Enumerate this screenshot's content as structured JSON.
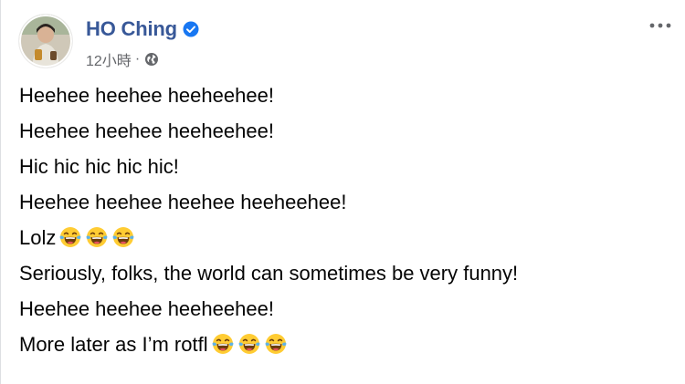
{
  "post": {
    "author": {
      "name": "HO Ching",
      "verified": true
    },
    "timestamp": "12小時",
    "separator": "·",
    "privacy_icon": "globe-icon",
    "more_icon": "more-options-icon",
    "lines": [
      {
        "text": "Heehee heehee heeheehee!",
        "emojis": 0
      },
      {
        "text": "Heehee heehee heeheehee!",
        "emojis": 0
      },
      {
        "text": "Hic hic hic hic hic!",
        "emojis": 0
      },
      {
        "text": "Heehee heehee heehee heeheehee!",
        "emojis": 0
      },
      {
        "text": "Lolz",
        "emojis": 3
      },
      {
        "text": "Seriously, folks, the world can sometimes be very funny!",
        "emojis": 0
      },
      {
        "text": "Heehee heehee heeheehee!",
        "emojis": 0
      },
      {
        "text": "More later as I’m rotfl",
        "emojis": 3
      }
    ],
    "emoji_name": "face-with-tears-of-joy-emoji"
  },
  "colors": {
    "author_name": "#385898",
    "meta_text": "#65676b",
    "verified_badge": "#1877f2",
    "emoji_face": "#ffcc33",
    "emoji_tears": "#5fb2e6"
  }
}
